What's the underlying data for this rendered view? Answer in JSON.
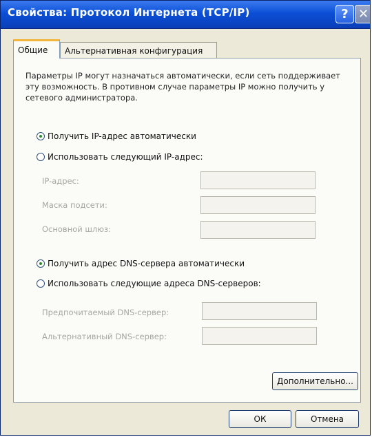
{
  "window": {
    "title": "Свойства: Протокол Интернета (TCP/IP)",
    "help_icon": "question-mark-icon",
    "close_icon": "close-icon"
  },
  "tabs": [
    {
      "label": "Общие",
      "active": true
    },
    {
      "label": "Альтернативная конфигурация",
      "active": false
    }
  ],
  "description": "Параметры IP могут назначаться автоматически, если сеть поддерживает эту возможность. В противном случае параметры IP можно получить у сетевого администратора.",
  "ip": {
    "auto_label": "Получить IP-адрес автоматически",
    "manual_label": "Использовать следующий IP-адрес:",
    "selected": "auto",
    "fields": [
      {
        "label": "IP-адрес:",
        "value": ""
      },
      {
        "label": "Маска подсети:",
        "value": ""
      },
      {
        "label": "Основной шлюз:",
        "value": ""
      }
    ]
  },
  "dns": {
    "auto_label": "Получить адрес DNS-сервера автоматически",
    "manual_label": "Использовать следующие адреса DNS-серверов:",
    "selected": "auto",
    "fields": [
      {
        "label": "Предпочитаемый DNS-сервер:",
        "value": ""
      },
      {
        "label": "Альтернативный DNS-сервер:",
        "value": ""
      }
    ]
  },
  "buttons": {
    "advanced": "Дополнительно...",
    "ok": "ОК",
    "cancel": "Отмена"
  },
  "colors": {
    "titlebar": "#0b4fd6",
    "dialog_bg": "#ece9d8",
    "active_tab_accent": "#f2b43a",
    "radio_dot": "#2b8a2b"
  }
}
